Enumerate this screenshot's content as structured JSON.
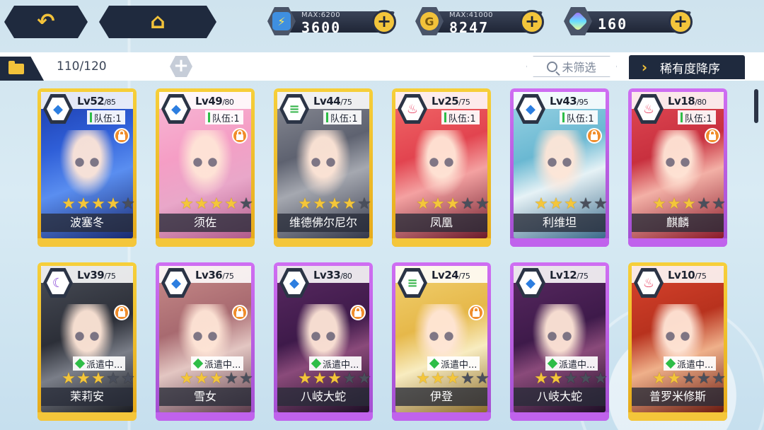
{
  "nav": {
    "back_icon": "back-arrow-icon",
    "home_icon": "home-icon"
  },
  "resources": {
    "stamina": {
      "max_label": "MAX:6200",
      "value": "3600",
      "icon": "stamina-battery-icon"
    },
    "gold": {
      "max_label": "MAX:41000",
      "value": "8247",
      "icon": "gold-coin-icon"
    },
    "gem": {
      "value": "160",
      "icon": "gem-icon"
    }
  },
  "toolbar": {
    "count": "110/120",
    "filter_label": "未筛选",
    "sort_label": "稀有度降序"
  },
  "colors": {
    "gold_frame": "#f4c63a",
    "purple_frame": "#c062ec",
    "accent_yellow": "#f2c23a",
    "dark_ui": "#1f2a3e"
  },
  "cards": [
    {
      "name": "波塞冬",
      "level": "Lv52",
      "max": "/85",
      "element": "water",
      "rarity": "gold",
      "stars": 4,
      "status": "队伍:1",
      "status_type": "team",
      "locked": true
    },
    {
      "name": "须佐",
      "level": "Lv49",
      "max": "/80",
      "element": "water",
      "rarity": "gold",
      "stars": 4,
      "status": "队伍:1",
      "status_type": "team",
      "locked": true
    },
    {
      "name": "维德佛尔尼尔",
      "level": "Lv44",
      "max": "/75",
      "element": "wind",
      "rarity": "gold",
      "stars": 4,
      "status": "队伍:1",
      "status_type": "team",
      "locked": false
    },
    {
      "name": "凤凰",
      "level": "Lv25",
      "max": "/75",
      "element": "fire",
      "rarity": "gold",
      "stars": 3,
      "status": "队伍:1",
      "status_type": "team",
      "locked": false
    },
    {
      "name": "利维坦",
      "level": "Lv43",
      "max": "/95",
      "element": "water",
      "rarity": "purple",
      "stars": 3,
      "status": "队伍:1",
      "status_type": "team",
      "locked": true
    },
    {
      "name": "麒麟",
      "level": "Lv18",
      "max": "/80",
      "element": "fire",
      "rarity": "purple",
      "stars": 3,
      "status": "队伍:1",
      "status_type": "team",
      "locked": true
    },
    {
      "name": "茉莉安",
      "level": "Lv39",
      "max": "/75",
      "element": "dark",
      "rarity": "gold",
      "stars": 3,
      "status": "派遣中...",
      "status_type": "dispatch",
      "locked": true
    },
    {
      "name": "雪女",
      "level": "Lv36",
      "max": "/75",
      "element": "water",
      "rarity": "purple",
      "stars": 3,
      "status": "派遣中...",
      "status_type": "dispatch",
      "locked": true
    },
    {
      "name": "八岐大蛇",
      "level": "Lv33",
      "max": "/80",
      "element": "water",
      "rarity": "purple",
      "stars": 3,
      "status": "派遣中...",
      "status_type": "dispatch",
      "locked": true
    },
    {
      "name": "伊登",
      "level": "Lv24",
      "max": "/75",
      "element": "wind",
      "rarity": "purple",
      "stars": 3,
      "status": "派遣中...",
      "status_type": "dispatch",
      "locked": true
    },
    {
      "name": "八岐大蛇",
      "level": "Lv12",
      "max": "/75",
      "element": "water",
      "rarity": "purple",
      "stars": 2,
      "status": "派遣中...",
      "status_type": "dispatch",
      "locked": false
    },
    {
      "name": "普罗米修斯",
      "level": "Lv10",
      "max": "/75",
      "element": "fire",
      "rarity": "gold",
      "stars": 2,
      "status": "派遣中...",
      "status_type": "dispatch",
      "locked": false
    }
  ]
}
